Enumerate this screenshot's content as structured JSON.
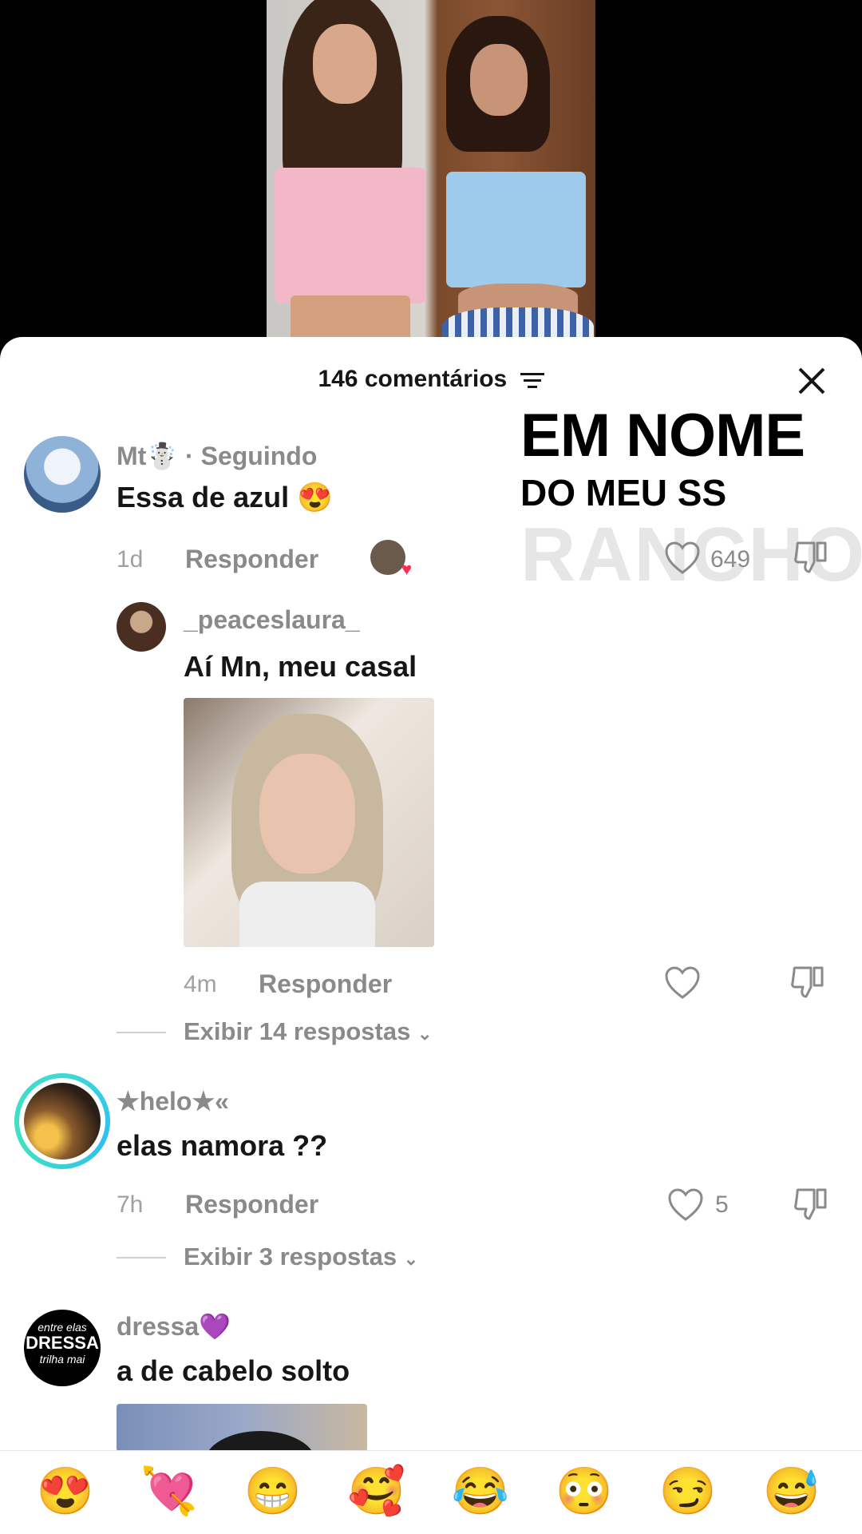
{
  "header": {
    "title": "146 comentários"
  },
  "overlay": {
    "line1": "EM NOME",
    "line2": "DO MEU SS",
    "line3": "RANCHO"
  },
  "comments": [
    {
      "username": "Mt☃️",
      "following": "· Seguindo",
      "text": "Essa de azul 😍",
      "time": "1d",
      "reply": "Responder",
      "likes": "649"
    },
    {
      "username": "_peaceslaura_",
      "text": "Aí Mn, meu casal",
      "time": "4m",
      "reply": "Responder",
      "view_more": "Exibir 14 respostas"
    },
    {
      "username": "★helo★«",
      "text": "elas namora ??",
      "time": "7h",
      "reply": "Responder",
      "likes": "5",
      "view_more": "Exibir 3 respostas"
    },
    {
      "username": "dressa💜",
      "text": "a de cabelo solto",
      "avatar_text": {
        "top": "entre elas",
        "mid": "DRESSA",
        "bot": "trilha mai"
      }
    }
  ],
  "emojis": [
    "😍",
    "💘",
    "😁",
    "🥰",
    "😂",
    "😳",
    "😏",
    "😅"
  ]
}
